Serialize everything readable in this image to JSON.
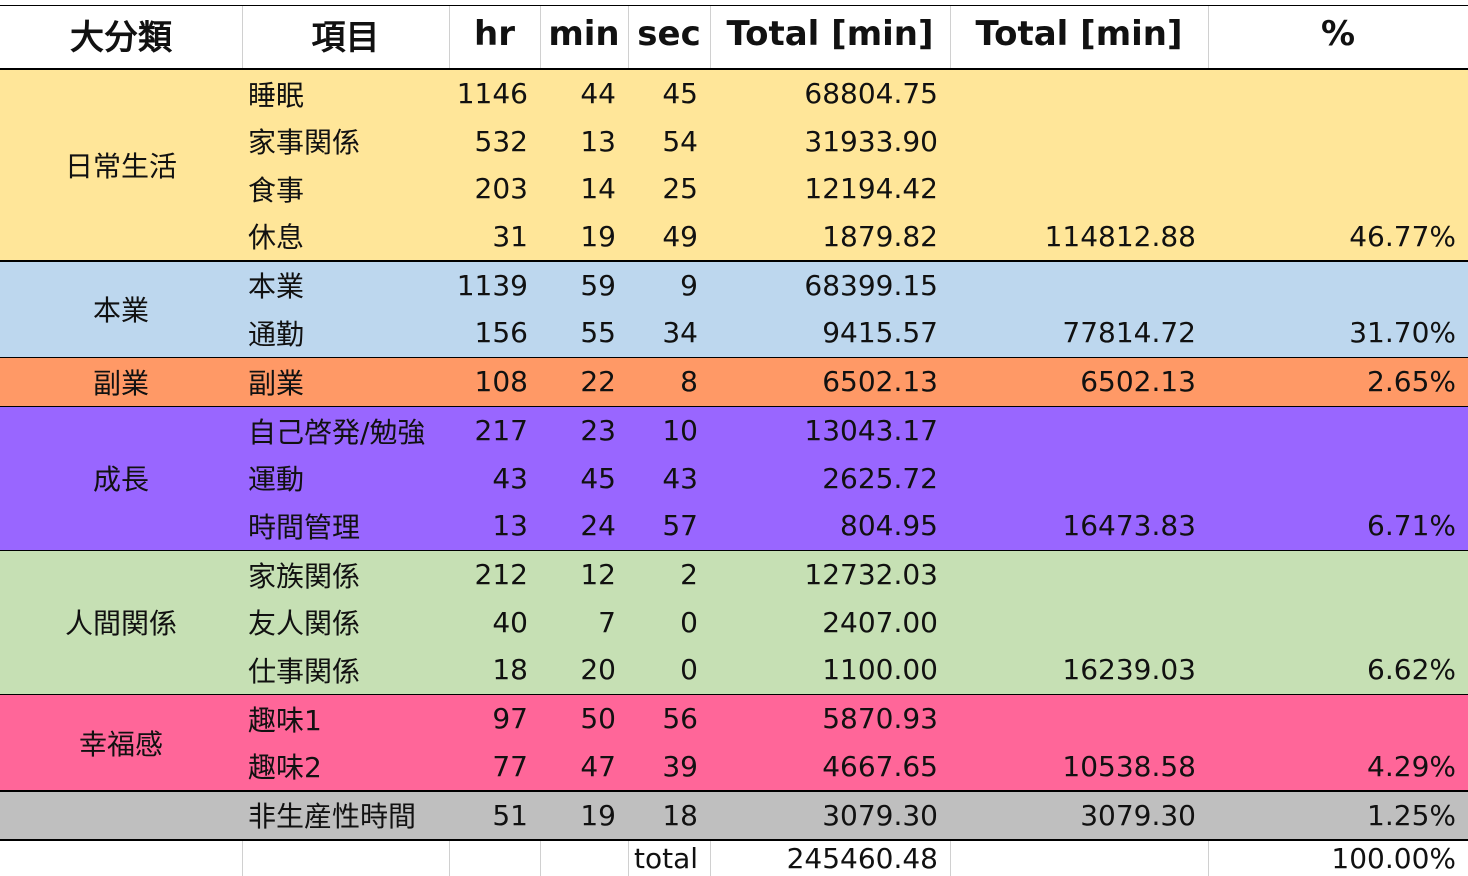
{
  "headers": [
    "大分類",
    "項目",
    "hr",
    "min",
    "sec",
    "Total [min]",
    "Total [min]",
    "%"
  ],
  "groups": [
    {
      "category": "日常生活",
      "color": "#FFE699",
      "subtotal": "114812.88",
      "percent": "46.77%",
      "items": [
        {
          "name": "睡眠",
          "hr": "1146",
          "min": "44",
          "sec": "45",
          "total": "68804.75"
        },
        {
          "name": "家事関係",
          "hr": "532",
          "min": "13",
          "sec": "54",
          "total": "31933.90"
        },
        {
          "name": "食事",
          "hr": "203",
          "min": "14",
          "sec": "25",
          "total": "12194.42"
        },
        {
          "name": "休息",
          "hr": "31",
          "min": "19",
          "sec": "49",
          "total": "1879.82"
        }
      ]
    },
    {
      "category": "本業",
      "color": "#BDD7EE",
      "subtotal": "77814.72",
      "percent": "31.70%",
      "items": [
        {
          "name": "本業",
          "hr": "1139",
          "min": "59",
          "sec": "9",
          "total": "68399.15"
        },
        {
          "name": "通勤",
          "hr": "156",
          "min": "55",
          "sec": "34",
          "total": "9415.57"
        }
      ]
    },
    {
      "category": "副業",
      "color": "#FF9966",
      "subtotal": "6502.13",
      "percent": "2.65%",
      "items": [
        {
          "name": "副業",
          "hr": "108",
          "min": "22",
          "sec": "8",
          "total": "6502.13"
        }
      ]
    },
    {
      "category": "成長",
      "color": "#9966FF",
      "subtotal": "16473.83",
      "percent": "6.71%",
      "items": [
        {
          "name": "自己啓発/勉強",
          "hr": "217",
          "min": "23",
          "sec": "10",
          "total": "13043.17"
        },
        {
          "name": "運動",
          "hr": "43",
          "min": "45",
          "sec": "43",
          "total": "2625.72"
        },
        {
          "name": "時間管理",
          "hr": "13",
          "min": "24",
          "sec": "57",
          "total": "804.95"
        }
      ]
    },
    {
      "category": "人間関係",
      "color": "#C6E0B4",
      "subtotal": "16239.03",
      "percent": "6.62%",
      "items": [
        {
          "name": "家族関係",
          "hr": "212",
          "min": "12",
          "sec": "2",
          "total": "12732.03"
        },
        {
          "name": "友人関係",
          "hr": "40",
          "min": "7",
          "sec": "0",
          "total": "2407.00"
        },
        {
          "name": "仕事関係",
          "hr": "18",
          "min": "20",
          "sec": "0",
          "total": "1100.00"
        }
      ]
    },
    {
      "category": "幸福感",
      "color": "#FF6699",
      "subtotal": "10538.58",
      "percent": "4.29%",
      "items": [
        {
          "name": "趣味1",
          "hr": "97",
          "min": "50",
          "sec": "56",
          "total": "5870.93"
        },
        {
          "name": "趣味2",
          "hr": "77",
          "min": "47",
          "sec": "39",
          "total": "4667.65"
        }
      ]
    },
    {
      "category": "",
      "color": "#BFBFBF",
      "subtotal": "3079.30",
      "percent": "1.25%",
      "items": [
        {
          "name": "非生産性時間",
          "hr": "51",
          "min": "19",
          "sec": "18",
          "total": "3079.30"
        }
      ]
    }
  ],
  "footer": {
    "label": "total",
    "grand_total": "245460.48",
    "percent": "100.00%"
  }
}
